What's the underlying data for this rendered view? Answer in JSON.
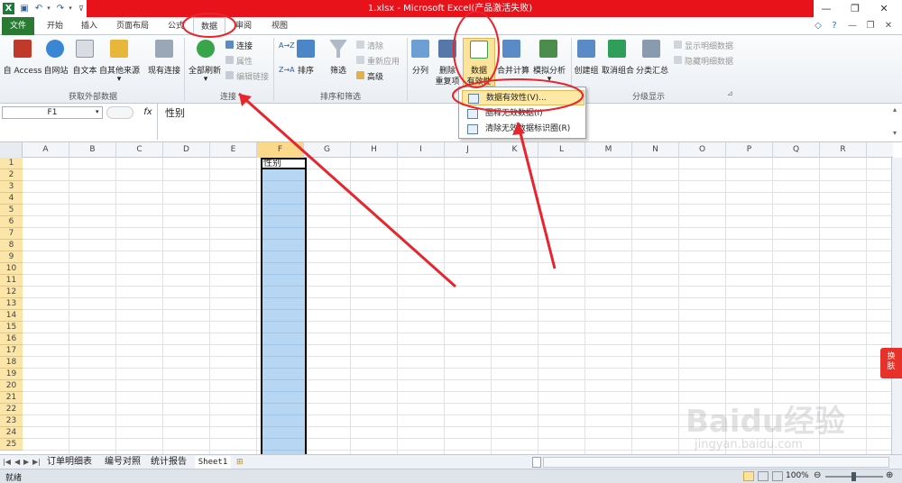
{
  "titlebar": {
    "title": "1.xlsx - Microsoft Excel(产品激活失败)",
    "qat_icons": [
      "excel-logo-icon",
      "save-icon",
      "undo-icon",
      "redo-icon",
      "customize-qat-icon"
    ],
    "window_controls": [
      "minimize-icon",
      "restore-icon",
      "close-icon"
    ]
  },
  "tabs": [
    "文件",
    "开始",
    "插入",
    "页面布局",
    "公式",
    "数据",
    "审阅",
    "视图"
  ],
  "ribbon": {
    "external": {
      "buttons": [
        "自 Access",
        "自网站",
        "自文本",
        "自其他来源",
        "现有连接"
      ],
      "group": "获取外部数据"
    },
    "connections": {
      "big": "全部刷新",
      "small": [
        "连接",
        "属性",
        "编辑链接"
      ],
      "group": "连接"
    },
    "sort": {
      "sort_az": "A→Z",
      "sort_za": "Z→A",
      "sort": "排序",
      "filter": "筛选",
      "small": [
        "清除",
        "重新应用",
        "高级"
      ],
      "group": "排序和筛选"
    },
    "tools": {
      "split": "分列",
      "remove_dup": [
        "删除",
        "重复项"
      ],
      "validation": [
        "数据",
        "有效性"
      ],
      "consolidate": "合并计算",
      "whatif": "模拟分析"
    },
    "outline": {
      "group_btn": "创建组",
      "ungroup": "取消组合",
      "subtotal": "分类汇总",
      "small": [
        "显示明细数据",
        "隐藏明细数据"
      ],
      "group": "分级显示"
    }
  },
  "formula_bar": {
    "name_box": "F1",
    "fx": "fx",
    "formula": "性别"
  },
  "grid": {
    "columns": [
      "A",
      "B",
      "C",
      "D",
      "E",
      "F",
      "G",
      "H",
      "I",
      "J",
      "K",
      "L",
      "M",
      "N",
      "O",
      "P",
      "Q",
      "R"
    ],
    "rows": [
      "1",
      "2",
      "3",
      "4",
      "5",
      "6",
      "7",
      "8",
      "9",
      "10",
      "11",
      "12",
      "13",
      "14",
      "15",
      "16",
      "17",
      "18",
      "19",
      "20",
      "21",
      "22",
      "23",
      "24",
      "25"
    ],
    "cell_F1": "性别"
  },
  "dropdown": {
    "items": [
      "数据有效性(V)...",
      "圈释无效数据(I)",
      "清除无效数据标识圈(R)"
    ]
  },
  "sheets": {
    "tabs": [
      "订单明细表",
      "编号对照",
      "统计报告",
      "Sheet1"
    ]
  },
  "status": {
    "ready": "就绪",
    "zoom": "100%"
  },
  "side_badge": [
    "换",
    "肤"
  ],
  "watermark": {
    "logo": "Baidu经验",
    "url": "jingyan.baidu.com"
  },
  "colors": {
    "title_red": "#e8121b",
    "file_tab_green": "#2a7a34",
    "selected_column": "#b7d6f3",
    "row_header_yellow": "#fce5a8",
    "annotation_red": "#e8242c"
  }
}
